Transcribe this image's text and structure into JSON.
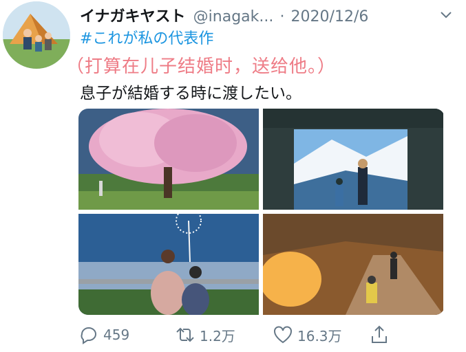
{
  "tweet": {
    "author": "イナガキヤスト",
    "handle": "@inagak...",
    "separator": "·",
    "date": "2020/12/6",
    "hashtag": "#これが私の代表作",
    "overlay_text": "（打算在儿子结婚时，送给他。）",
    "body": "息子が結婚する時に渡したい。"
  },
  "actions": {
    "reply_count": "459",
    "retweet_count": "1.2万",
    "like_count": "16.3万"
  },
  "icons": {
    "reply": "reply-bubble-icon",
    "retweet": "retweet-icon",
    "like": "heart-icon",
    "share": "share-icon",
    "more": "chevron-down-icon"
  },
  "colors": {
    "link": "#1b95e0",
    "overlay": "#ee7c86",
    "muted": "#657786"
  }
}
